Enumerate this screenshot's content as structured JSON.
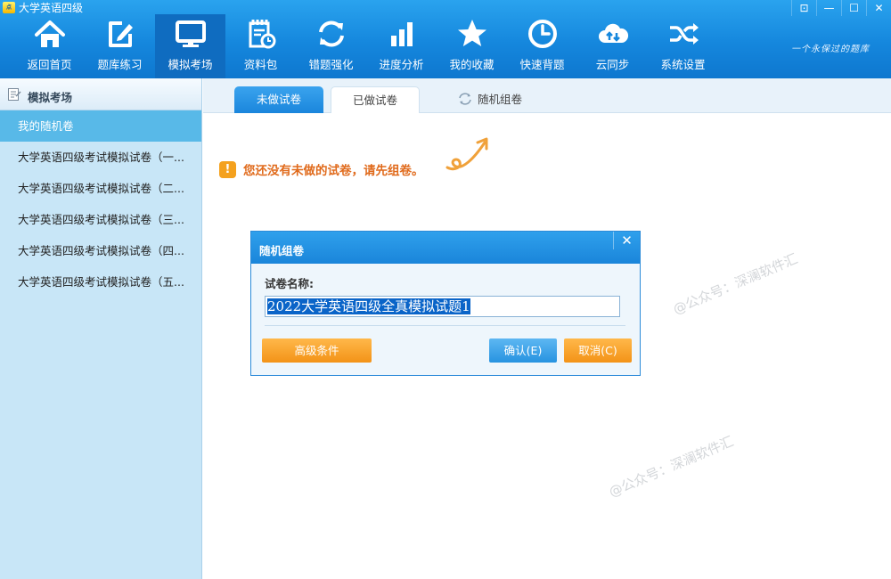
{
  "app": {
    "title": "大学英语四级",
    "logo_text": "点"
  },
  "window_controls": [
    {
      "name": "restore-button",
      "symbol": "⊡"
    },
    {
      "name": "minimize-button",
      "symbol": "—"
    },
    {
      "name": "maximize-button",
      "symbol": "☐"
    },
    {
      "name": "close-button",
      "symbol": "✕"
    }
  ],
  "slogan": "一个永保过的题库",
  "nav": [
    {
      "label": "返回首页",
      "icon": "home-icon"
    },
    {
      "label": "题库练习",
      "icon": "edit-icon"
    },
    {
      "label": "模拟考场",
      "icon": "monitor-icon",
      "active": true
    },
    {
      "label": "资料包",
      "icon": "notepad-clock-icon"
    },
    {
      "label": "错题强化",
      "icon": "refresh-icon"
    },
    {
      "label": "进度分析",
      "icon": "bar-chart-icon"
    },
    {
      "label": "我的收藏",
      "icon": "star-icon"
    },
    {
      "label": "快速背题",
      "icon": "clock-icon"
    },
    {
      "label": "云同步",
      "icon": "cloud-sync-icon"
    },
    {
      "label": "系统设置",
      "icon": "shuffle-icon"
    }
  ],
  "sidebar": {
    "title": "模拟考场",
    "items": [
      {
        "label": "我的随机卷",
        "active": true
      },
      {
        "label": "大学英语四级考试模拟试卷（一..."
      },
      {
        "label": "大学英语四级考试模拟试卷（二..."
      },
      {
        "label": "大学英语四级考试模拟试卷（三..."
      },
      {
        "label": "大学英语四级考试模拟试卷（四..."
      },
      {
        "label": "大学英语四级考试模拟试卷（五..."
      }
    ]
  },
  "tabs": {
    "undone": "未做试卷",
    "done": "已做试卷",
    "random": "随机组卷"
  },
  "notice": {
    "icon_text": "!",
    "message": "您还没有未做的试卷，请先组卷。"
  },
  "watermark": "@公众号：深澜软件汇",
  "dialog": {
    "title": "随机组卷",
    "close": "✕",
    "name_label": "试卷名称:",
    "name_value": "2022大学英语四级全真模拟试题1",
    "advanced_button": "高级条件",
    "ok_button": "确认(E)",
    "cancel_button": "取消(C)"
  },
  "colors": {
    "header": "#1587dd",
    "sidebar_bg": "#c8e6f7",
    "sidebar_active": "#58b9e8",
    "notice_text": "#e06a1b",
    "orange_button": "#f39317",
    "blue_button": "#2793e0"
  }
}
